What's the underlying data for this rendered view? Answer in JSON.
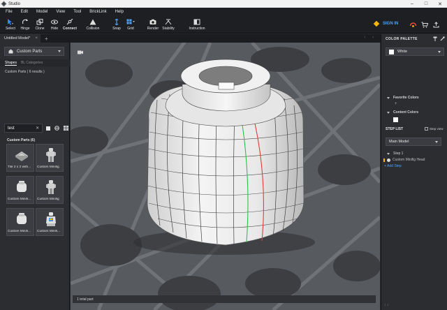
{
  "window": {
    "title": "Studio"
  },
  "menu": [
    "File",
    "Edit",
    "Model",
    "View",
    "Tool",
    "BrickLink",
    "Help"
  ],
  "toolbar": {
    "tools": [
      {
        "label": "Select",
        "icon": "cursor-icon"
      },
      {
        "label": "Hinge",
        "icon": "hinge-icon"
      },
      {
        "label": "Clone",
        "icon": "clone-icon"
      },
      {
        "label": "Hide",
        "icon": "eye-icon"
      },
      {
        "label": "Connect",
        "icon": "connect-icon"
      },
      {
        "label": "Collision",
        "icon": "collision-icon"
      },
      {
        "label": "Snap",
        "icon": "snap-icon"
      },
      {
        "label": "Grid",
        "icon": "grid-icon"
      },
      {
        "label": "Render",
        "icon": "camera-icon"
      },
      {
        "label": "Stability",
        "icon": "stability-icon"
      },
      {
        "label": "Instruction",
        "icon": "instruction-icon"
      }
    ],
    "sign_in": "SIGN IN"
  },
  "tabs": {
    "active": "Untitled Model*"
  },
  "left_panel": {
    "library": "Custom Parts",
    "subtabs": [
      "Shapes",
      "BL Categories"
    ],
    "results": "Custom Parts ( 6 results )",
    "search_value": "test",
    "group_title": "Custom Parts (6)",
    "parts": [
      {
        "name": "Tile 2 x 2 with..."
      },
      {
        "name": "Custom Minifig"
      },
      {
        "name": "Custom Minifi..."
      },
      {
        "name": "Custom Minifig"
      },
      {
        "name": "Custom Minifi..."
      },
      {
        "name": "Custom Minifi..."
      }
    ]
  },
  "viewport": {
    "status": "1 total part"
  },
  "right_panel": {
    "title": "COLOR PALETTE",
    "selected_color": "White",
    "selected_color_hex": "#ffffff",
    "favorite_colors": "Favorite Colors",
    "content_colors": "Content Colors",
    "step_list": "STEP LIST",
    "step_view": "Step view",
    "model": "Main Model",
    "step": "Step 1",
    "step_item": "Custom Minifig Head",
    "add_step": "+ Add Step"
  }
}
